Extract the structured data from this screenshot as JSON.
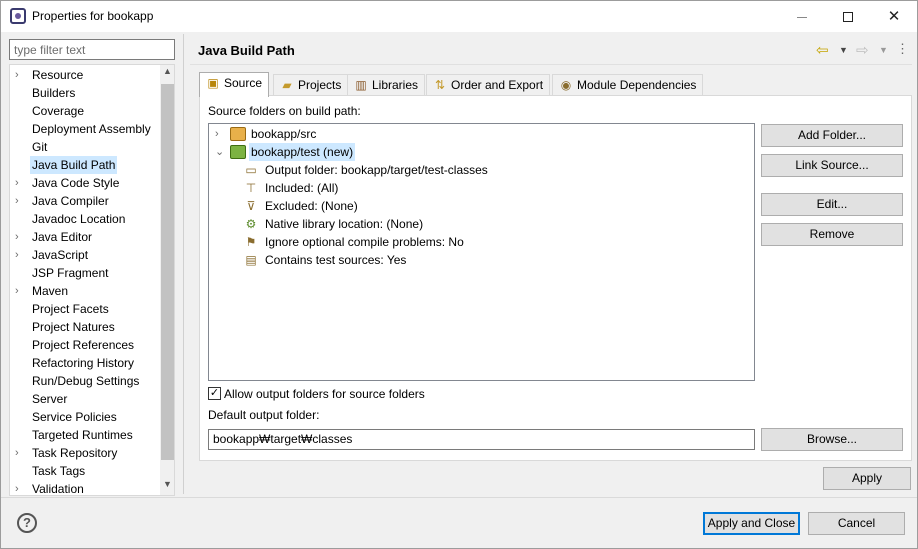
{
  "window": {
    "title": "Properties for bookapp",
    "min_label": "",
    "max_label": "",
    "close_label": "✕"
  },
  "sidebar": {
    "filter_placeholder": "type filter text",
    "items": [
      {
        "label": "Resource",
        "expandable": true
      },
      {
        "label": "Builders",
        "expandable": false
      },
      {
        "label": "Coverage",
        "expandable": false
      },
      {
        "label": "Deployment Assembly",
        "expandable": false
      },
      {
        "label": "Git",
        "expandable": false
      },
      {
        "label": "Java Build Path",
        "expandable": false,
        "selected": true
      },
      {
        "label": "Java Code Style",
        "expandable": true
      },
      {
        "label": "Java Compiler",
        "expandable": true
      },
      {
        "label": "Javadoc Location",
        "expandable": false
      },
      {
        "label": "Java Editor",
        "expandable": true
      },
      {
        "label": "JavaScript",
        "expandable": true
      },
      {
        "label": "JSP Fragment",
        "expandable": false
      },
      {
        "label": "Maven",
        "expandable": true
      },
      {
        "label": "Project Facets",
        "expandable": false
      },
      {
        "label": "Project Natures",
        "expandable": false
      },
      {
        "label": "Project References",
        "expandable": false
      },
      {
        "label": "Refactoring History",
        "expandable": false
      },
      {
        "label": "Run/Debug Settings",
        "expandable": false
      },
      {
        "label": "Server",
        "expandable": false
      },
      {
        "label": "Service Policies",
        "expandable": false
      },
      {
        "label": "Targeted Runtimes",
        "expandable": false
      },
      {
        "label": "Task Repository",
        "expandable": true
      },
      {
        "label": "Task Tags",
        "expandable": false
      },
      {
        "label": "Validation",
        "expandable": true
      }
    ]
  },
  "page": {
    "title": "Java Build Path",
    "tabs": [
      {
        "label": "Source",
        "icon": "source-icon",
        "active": true
      },
      {
        "label": "Projects",
        "icon": "projects-icon"
      },
      {
        "label": "Libraries",
        "icon": "libraries-icon"
      },
      {
        "label": "Order and Export",
        "icon": "order-export-icon"
      },
      {
        "label": "Module Dependencies",
        "icon": "module-icon"
      }
    ],
    "source_label": "Source folders on build path:",
    "tree": {
      "src": "bookapp/src",
      "test": "bookapp/test (new)",
      "children": [
        "Output folder: bookapp/target/test-classes",
        "Included: (All)",
        "Excluded: (None)",
        "Native library location: (None)",
        "Ignore optional compile problems: No",
        "Contains test sources: Yes"
      ]
    },
    "buttons": {
      "add_folder": "Add Folder...",
      "link_source": "Link Source...",
      "edit": "Edit...",
      "remove": "Remove",
      "browse": "Browse..."
    },
    "allow_output_label": "Allow output folders for source folders",
    "allow_output_checked": true,
    "default_output_label": "Default output folder:",
    "default_output_value": "bookapp₩target₩classes",
    "apply": "Apply"
  },
  "footer": {
    "help": "?",
    "apply_close": "Apply and Close",
    "cancel": "Cancel"
  }
}
